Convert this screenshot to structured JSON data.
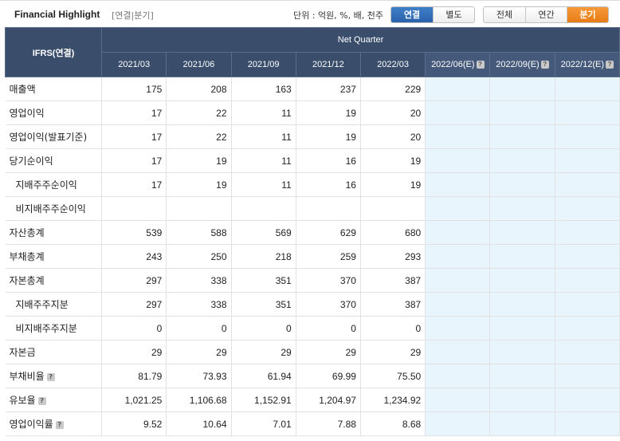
{
  "header": {
    "title": "Financial Highlight",
    "subtitle": "[연결|분기]",
    "unit_label": "단위 : 억원, %, 배, 천주",
    "consolidation_tabs": [
      {
        "label": "연결",
        "active": true
      },
      {
        "label": "별도",
        "active": false
      }
    ],
    "period_tabs": [
      {
        "label": "전체",
        "active": false
      },
      {
        "label": "연간",
        "active": false
      },
      {
        "label": "분기",
        "active": true
      }
    ]
  },
  "table": {
    "corner_label": "IFRS(연결)",
    "group_label": "Net Quarter",
    "help_icon_glyph": "?",
    "periods": [
      "2021/03",
      "2021/06",
      "2021/09",
      "2021/12",
      "2022/03",
      "2022/06(E)",
      "2022/09(E)",
      "2022/12(E)"
    ],
    "estimate_flags": [
      false,
      false,
      false,
      false,
      false,
      true,
      true,
      true
    ],
    "rows": [
      {
        "label": "매출액",
        "indent": false,
        "help": false,
        "values": [
          "175",
          "208",
          "163",
          "237",
          "229",
          "",
          "",
          ""
        ]
      },
      {
        "label": "영업이익",
        "indent": false,
        "help": false,
        "values": [
          "17",
          "22",
          "11",
          "19",
          "20",
          "",
          "",
          ""
        ]
      },
      {
        "label": "영업이익(발표기준)",
        "indent": false,
        "help": false,
        "values": [
          "17",
          "22",
          "11",
          "19",
          "20",
          "",
          "",
          ""
        ]
      },
      {
        "label": "당기순이익",
        "indent": false,
        "help": false,
        "values": [
          "17",
          "19",
          "11",
          "16",
          "19",
          "",
          "",
          ""
        ]
      },
      {
        "label": "지배주주순이익",
        "indent": true,
        "help": false,
        "values": [
          "17",
          "19",
          "11",
          "16",
          "19",
          "",
          "",
          ""
        ]
      },
      {
        "label": "비지배주주순이익",
        "indent": true,
        "help": false,
        "values": [
          "",
          "",
          "",
          "",
          "",
          "",
          "",
          ""
        ]
      },
      {
        "label": "자산총계",
        "indent": false,
        "help": false,
        "values": [
          "539",
          "588",
          "569",
          "629",
          "680",
          "",
          "",
          ""
        ]
      },
      {
        "label": "부채총계",
        "indent": false,
        "help": false,
        "values": [
          "243",
          "250",
          "218",
          "259",
          "293",
          "",
          "",
          ""
        ]
      },
      {
        "label": "자본총계",
        "indent": false,
        "help": false,
        "values": [
          "297",
          "338",
          "351",
          "370",
          "387",
          "",
          "",
          ""
        ]
      },
      {
        "label": "지배주주지분",
        "indent": true,
        "help": false,
        "values": [
          "297",
          "338",
          "351",
          "370",
          "387",
          "",
          "",
          ""
        ]
      },
      {
        "label": "비지배주주지분",
        "indent": true,
        "help": false,
        "values": [
          "0",
          "0",
          "0",
          "0",
          "0",
          "",
          "",
          ""
        ]
      },
      {
        "label": "자본금",
        "indent": false,
        "help": false,
        "values": [
          "29",
          "29",
          "29",
          "29",
          "29",
          "",
          "",
          ""
        ]
      },
      {
        "label": "부채비율",
        "indent": false,
        "help": true,
        "values": [
          "81.79",
          "73.93",
          "61.94",
          "69.99",
          "75.50",
          "",
          "",
          ""
        ]
      },
      {
        "label": "유보율",
        "indent": false,
        "help": true,
        "values": [
          "1,021.25",
          "1,106.68",
          "1,152.91",
          "1,204.97",
          "1,234.92",
          "",
          "",
          ""
        ]
      },
      {
        "label": "영업이익률",
        "indent": false,
        "help": true,
        "values": [
          "9.52",
          "10.64",
          "7.01",
          "7.88",
          "8.68",
          "",
          "",
          ""
        ]
      }
    ]
  }
}
